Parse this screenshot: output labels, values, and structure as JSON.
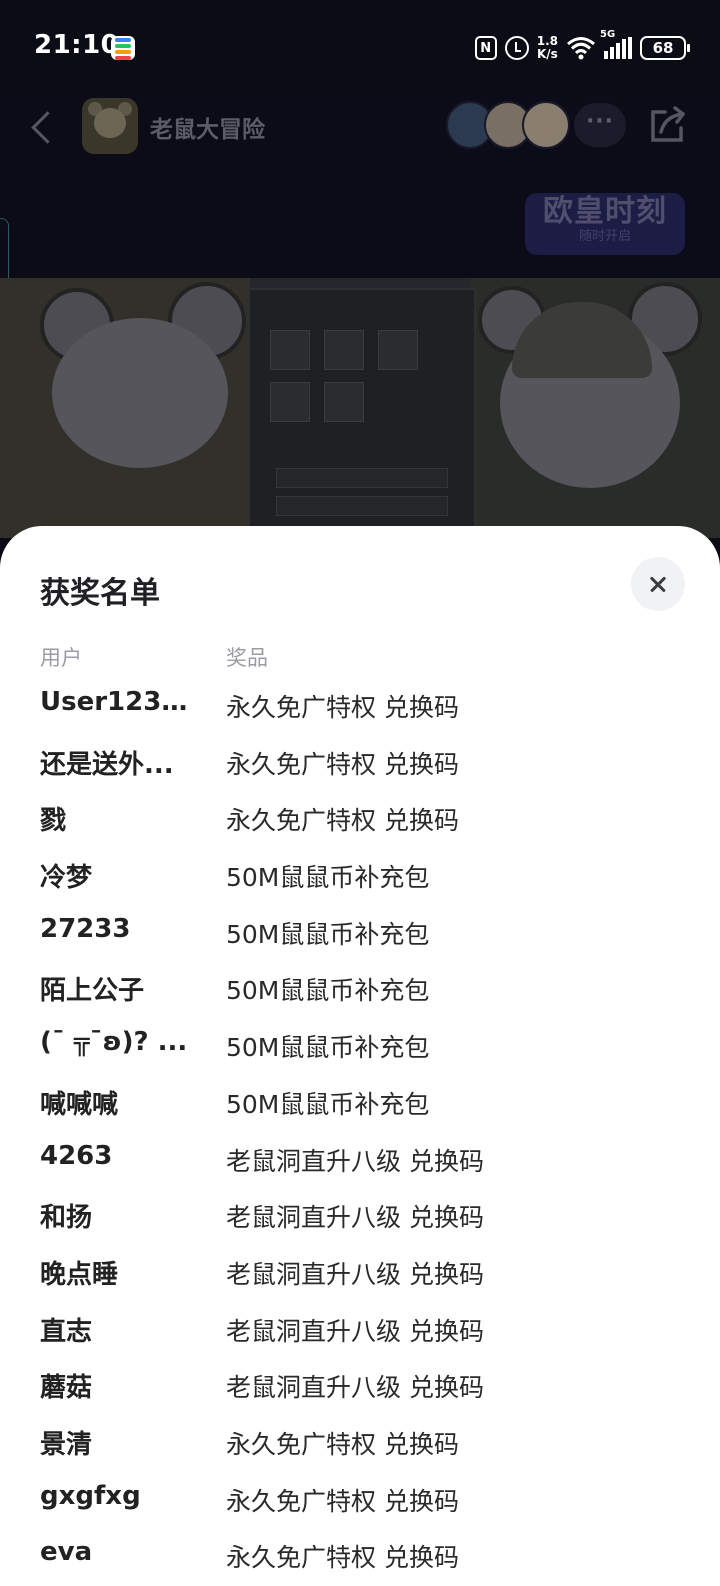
{
  "status_bar": {
    "time": "21:10",
    "net_speed_value": "1.8",
    "net_speed_unit": "K/s",
    "network_type": "5G",
    "battery": "68"
  },
  "app_header": {
    "game_name": "老鼠大冒险",
    "more_label": "···",
    "avatar_colors": [
      "#2b3a4f",
      "#7a6f63",
      "#8a7f6e"
    ]
  },
  "banner": {
    "badge_title": "欧皇时刻",
    "badge_subtitle": "随时开启"
  },
  "sheet": {
    "title": "获奖名单",
    "col_user": "用户",
    "col_prize": "奖品",
    "rows": [
      {
        "user": "User123...",
        "prize": "永久免广特权 兑换码"
      },
      {
        "user": "还是送外...",
        "prize": "永久免广特权 兑换码"
      },
      {
        "user": "戮",
        "prize": "永久免广特权 兑换码"
      },
      {
        "user": "冷梦",
        "prize": "50M鼠鼠币补充包"
      },
      {
        "user": "27233",
        "prize": "50M鼠鼠币补充包"
      },
      {
        "user": "陌上公子",
        "prize": "50M鼠鼠币补充包"
      },
      {
        "user": "(¯ ╦¯ʚ)? ...",
        "prize": "50M鼠鼠币补充包"
      },
      {
        "user": "喊喊喊",
        "prize": "50M鼠鼠币补充包"
      },
      {
        "user": "4263",
        "prize": "老鼠洞直升八级 兑换码"
      },
      {
        "user": "和扬",
        "prize": "老鼠洞直升八级 兑换码"
      },
      {
        "user": "晚点睡",
        "prize": "老鼠洞直升八级 兑换码"
      },
      {
        "user": "直志",
        "prize": "老鼠洞直升八级 兑换码"
      },
      {
        "user": "蘑菇",
        "prize": "老鼠洞直升八级 兑换码"
      },
      {
        "user": "景清",
        "prize": "永久免广特权 兑换码"
      },
      {
        "user": "gxgfxg",
        "prize": "永久免广特权 兑换码"
      },
      {
        "user": "eva",
        "prize": "永久免广特权 兑换码"
      }
    ]
  },
  "colors": {
    "overlay_bg": "#0c0c16",
    "sheet_bg": "#ffffff",
    "primary_text": "#222222",
    "secondary_text": "#9a9ca3"
  }
}
